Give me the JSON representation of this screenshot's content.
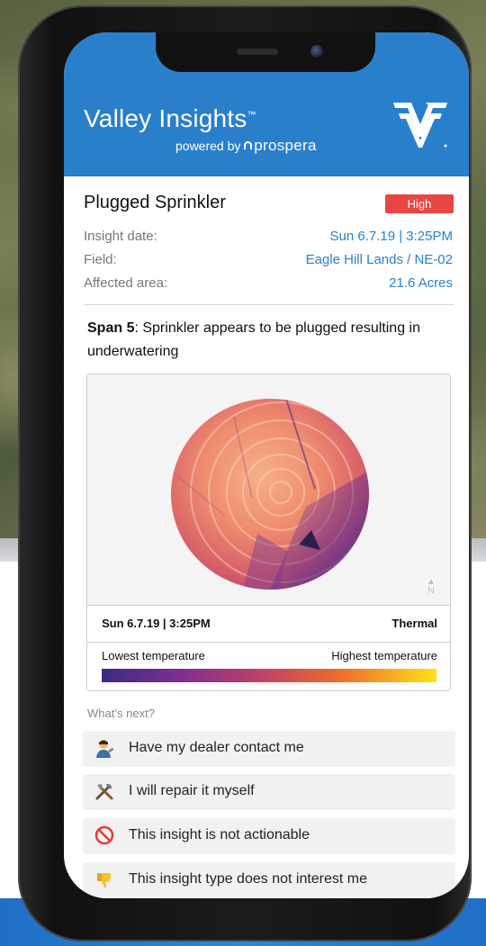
{
  "app": {
    "title": "Valley Insights",
    "trademark": "™",
    "powered_by": "powered by",
    "partner": "prospera"
  },
  "insight": {
    "title": "Plugged Sprinkler",
    "severity": "High",
    "details": [
      {
        "label": "Insight date:",
        "value": "Sun 6.7.19 | 3:25PM"
      },
      {
        "label": "Field:",
        "value": "Eagle Hill Lands / NE-02"
      },
      {
        "label": "Affected area:",
        "value": "21.6 Acres"
      }
    ],
    "description_bold": "Span 5",
    "description_text": ": Sprinkler appears to be plugged resulting in underwatering"
  },
  "image_card": {
    "date": "Sun 6.7.19 | 3:25PM",
    "mode": "Thermal",
    "north_label": "N",
    "legend_low": "Lowest temperature",
    "legend_high": "Highest temperature",
    "ramp_colors": [
      "#3b2a86",
      "#7a2f8e",
      "#c0416a",
      "#ec6a2e",
      "#f7a823",
      "#ffe313"
    ]
  },
  "next_steps": {
    "heading": "What’s next?",
    "actions": [
      {
        "icon": "dealer-icon",
        "label": "Have my dealer contact me"
      },
      {
        "icon": "tools-icon",
        "label": "I will repair it myself"
      },
      {
        "icon": "prohibited-icon",
        "label": "This insight is not actionable"
      },
      {
        "icon": "thumbs-down-icon",
        "label": "This insight type does not interest me"
      }
    ]
  },
  "colors": {
    "brand_blue": "#2a7fcb",
    "severity_red": "#e84545"
  }
}
